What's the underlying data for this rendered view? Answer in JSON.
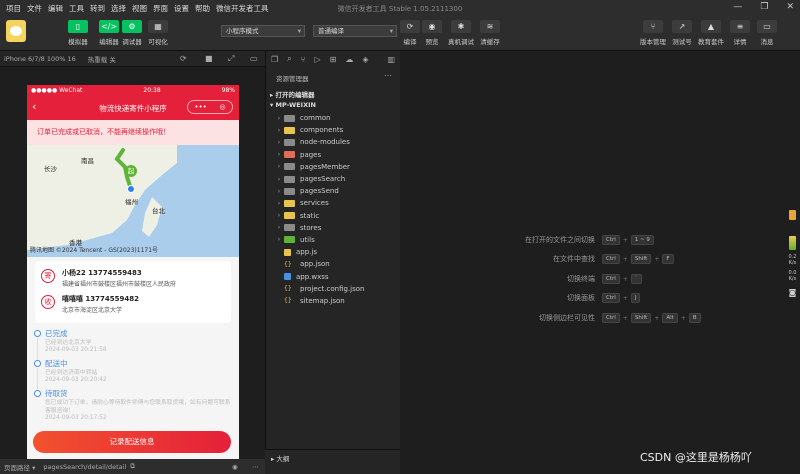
{
  "menubar": {
    "items": [
      "项目",
      "文件",
      "编辑",
      "工具",
      "转到",
      "选择",
      "视图",
      "界面",
      "设置",
      "帮助",
      "微信开发者工具"
    ],
    "title": "微信开发者工具 Stable 1.05.2111300"
  },
  "toolbar": {
    "left_buttons": [
      "模拟器",
      "编辑器",
      "调试器",
      "可视化"
    ],
    "mode_select": "小程序模式",
    "compile_select": "普通编译",
    "mid_buttons": [
      "编译",
      "预览",
      "真机调试",
      "清缓存"
    ],
    "right_buttons": [
      "版本管理",
      "测试号",
      "教育套件",
      "详情",
      "消息"
    ]
  },
  "simulator_bar": {
    "device": "iPhone 6/7/8 100% 16",
    "hot_reload": "热重载 关"
  },
  "phone": {
    "status_left": "●●●●● WeChat",
    "status_time": "20:38",
    "status_right": "98%",
    "nav_title": "物流快递寄件小程序",
    "alert": "订单已完成或已取消，不能再继续操作哦！",
    "map": {
      "labels": [
        "南昌",
        "长沙",
        "福州",
        "台北",
        "香港",
        "起"
      ],
      "footer": "腾讯地图 ©2024 Tencent - GS(2023)1171号"
    },
    "sender": {
      "badge": "寄",
      "name": "小杨22  13774559483",
      "address": "福建省福州市鼓楼区福州市鼓楼区人民政府"
    },
    "receiver": {
      "badge": "收",
      "name": "嘻嘻嘻  13774559482",
      "address": "北京市海淀区北京大学"
    },
    "timeline": [
      {
        "status": "已完成",
        "desc": "已经到达北京大学",
        "time": "2024-09-03 20:21:58"
      },
      {
        "status": "配送中",
        "desc": "已经到达济南中转站",
        "time": "2024-09-03 20:20:42"
      },
      {
        "status": "待取货",
        "desc": "您已成功下订单，请耐心等待取件师傅与您联系取货哦，如有问题可联系客服咨询！",
        "time": "2024-09-03 20:17:52"
      }
    ],
    "button": "记录配送信息"
  },
  "bottom_bar": {
    "label": "页面路径 ▾",
    "path": "pagesSearch/detail/detail"
  },
  "explorer": {
    "header": "资源管理器",
    "open_editors": "打开的编辑器",
    "project": "MP-WEIXIN",
    "folders": [
      "common",
      "components",
      "node-modules",
      "pages",
      "pagesMember",
      "pagesSearch",
      "pagesSend",
      "services",
      "static",
      "stores",
      "utils"
    ],
    "files": [
      "app.js",
      "app.json",
      "app.wxss",
      "project.config.json",
      "sitemap.json"
    ],
    "outline": "大纲"
  },
  "shortcuts": [
    {
      "label": "在打开的文件之间切换",
      "keys": [
        "Ctrl",
        "1 ~ 9"
      ]
    },
    {
      "label": "在文件中查找",
      "keys": [
        "Ctrl",
        "Shift",
        "F"
      ]
    },
    {
      "label": "切换终端",
      "keys": [
        "Ctrl",
        "`"
      ]
    },
    {
      "label": "切换面板",
      "keys": [
        "Ctrl",
        "J"
      ]
    },
    {
      "label": "切换侧边栏可见性",
      "keys": [
        "Ctrl",
        "Shift",
        "Alt",
        "B"
      ]
    }
  ],
  "right_stats": [
    "0.2 K/s",
    "0.0 K/s"
  ],
  "watermark": "CSDN @这里是杨杨吖",
  "colors": {
    "brand_red": "#e5203a",
    "wechat_green": "#07c160",
    "timeline_blue": "#4a8fe2"
  }
}
